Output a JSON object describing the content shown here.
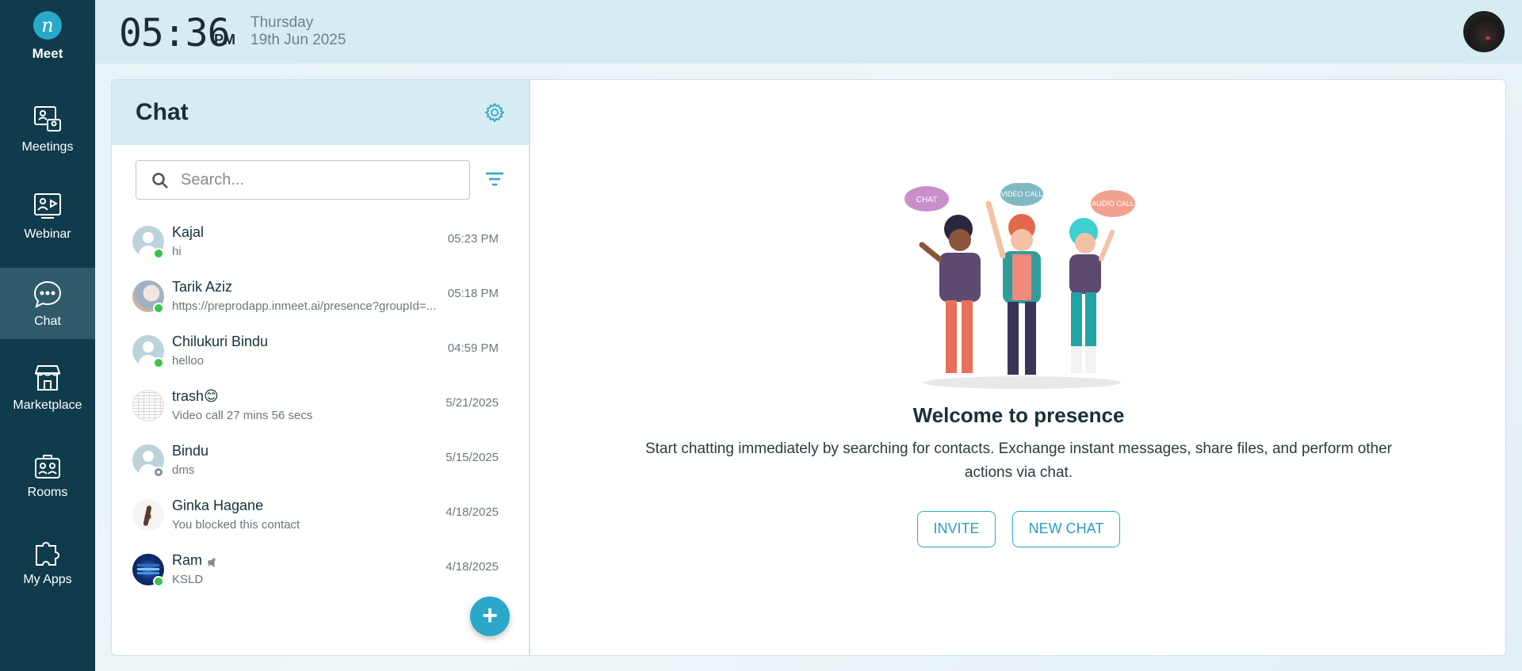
{
  "app": {
    "logo_letter": "n",
    "name": "Meet"
  },
  "sidebar": {
    "items": [
      {
        "label": "Meetings",
        "icon": "meetings-icon"
      },
      {
        "label": "Webinar",
        "icon": "webinar-icon"
      },
      {
        "label": "Chat",
        "icon": "chat-icon",
        "active": true
      },
      {
        "label": "Marketplace",
        "icon": "marketplace-icon"
      },
      {
        "label": "Rooms",
        "icon": "rooms-icon"
      },
      {
        "label": "My Apps",
        "icon": "puzzle-icon"
      }
    ]
  },
  "header": {
    "time": "05:36",
    "ampm": "PM",
    "day": "Thursday",
    "date": "19th Jun 2025"
  },
  "chat": {
    "title": "Chat",
    "search_placeholder": "Search...",
    "contacts": [
      {
        "name": "Kajal",
        "message": "hi",
        "time": "05:23 PM",
        "status": "online",
        "avatar": "generic"
      },
      {
        "name": "Tarik Aziz",
        "message": "https://preprodapp.inmeet.ai/presence?groupId=...",
        "time": "05:18 PM",
        "status": "online",
        "avatar": "photo"
      },
      {
        "name": "Chilukuri Bindu",
        "message": "helloo",
        "time": "04:59 PM",
        "status": "online",
        "avatar": "generic"
      },
      {
        "name": "trash😊",
        "message": "Video call 27 mins 56 secs",
        "time": "5/21/2025",
        "status": "none",
        "avatar": "group"
      },
      {
        "name": "Bindu",
        "message": "dms",
        "time": "5/15/2025",
        "status": "away",
        "avatar": "generic"
      },
      {
        "name": "Ginka Hagane",
        "message": "You blocked this contact",
        "time": "4/18/2025",
        "status": "none",
        "avatar": "photo"
      },
      {
        "name": "Ram",
        "message": "KSLD",
        "time": "4/18/2025",
        "status": "online",
        "avatar": "photo",
        "muted": true
      }
    ],
    "fab_label": "+"
  },
  "welcome": {
    "bubble_chat": "CHAT",
    "bubble_video": "VIDEO CALL",
    "bubble_audio": "AUDIO CALL",
    "title": "Welcome to presence",
    "text": "Start chatting immediately by searching for contacts. Exchange instant messages, share files, and perform other actions via chat.",
    "invite_label": "INVITE",
    "new_chat_label": "NEW CHAT"
  },
  "colors": {
    "sidebar": "#0f3b4c",
    "sidebar_active": "#2f5a6a",
    "accent": "#2aa8c9",
    "online": "#3cc24a",
    "header_bg": "#d6ebf2"
  }
}
